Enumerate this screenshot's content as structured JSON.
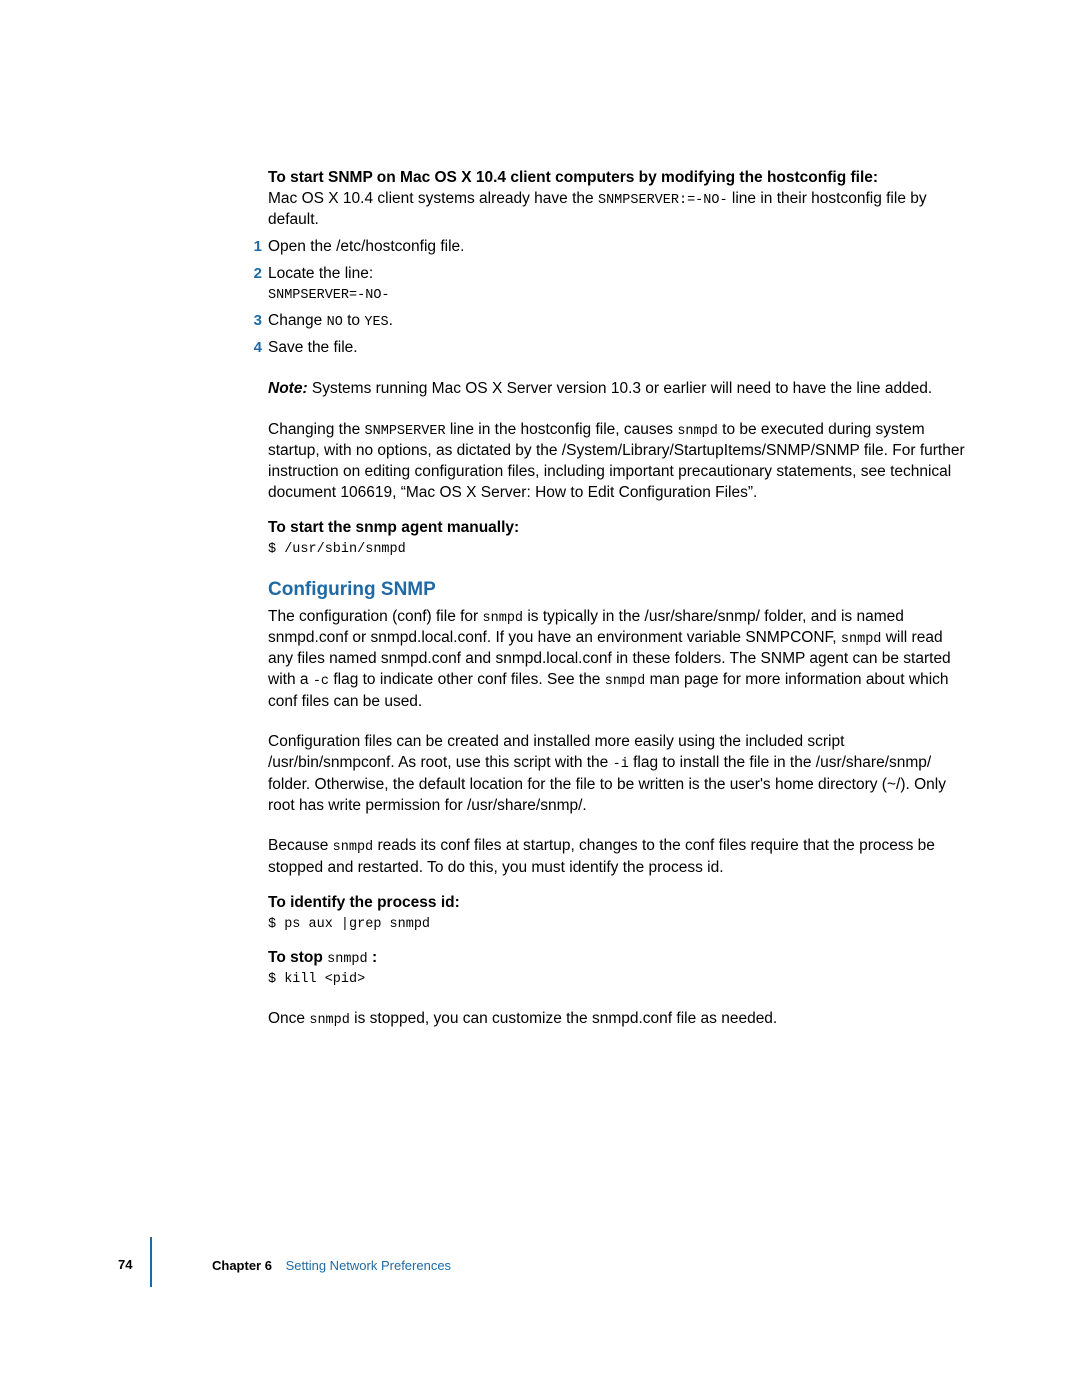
{
  "intro_heading": "To start SNMP on Mac OS X 10.4 client computers by modifying the hostconfig file:",
  "intro_text_1": "Mac OS X 10.4 client systems already have the ",
  "intro_code_1": "SNMPSERVER:=-NO-",
  "intro_text_2": " line in their hostconfig file by default.",
  "steps": [
    {
      "num": "1",
      "text": "Open the /etc/hostconfig file."
    },
    {
      "num": "2",
      "text": "Locate the line:",
      "code": "SNMPSERVER=-NO-"
    },
    {
      "num": "3",
      "parts": [
        {
          "t": "Change "
        },
        {
          "t": "NO",
          "code": true
        },
        {
          "t": " to "
        },
        {
          "t": "YES",
          "code": true
        },
        {
          "t": "."
        }
      ]
    },
    {
      "num": "4",
      "text": "Save the file."
    }
  ],
  "note_label": "Note:",
  "note_text": "  Systems running Mac OS X Server version 10.3 or earlier will need to have the line added.",
  "para_changing_parts": [
    {
      "t": "Changing the "
    },
    {
      "t": "SNMPSERVER",
      "code": true
    },
    {
      "t": " line in the hostconfig file, causes "
    },
    {
      "t": "snmpd",
      "code": true
    },
    {
      "t": " to be executed during system startup, with no options, as dictated by the /System/Library/StartupItems/SNMP/SNMP file. For further instruction on editing configuration files, including important precautionary statements, see technical document 106619, “Mac OS X Server: How to Edit Configuration Files”."
    }
  ],
  "manual_heading": "To start the snmp agent manually:",
  "manual_code": "$ /usr/sbin/snmpd",
  "config_heading": "Configuring SNMP",
  "config_p1_parts": [
    {
      "t": "The configuration (conf) file for "
    },
    {
      "t": "snmpd",
      "code": true
    },
    {
      "t": " is typically in the /usr/share/snmp/ folder, and is named snmpd.conf or snmpd.local.conf. If you have an environment variable SNMPCONF, "
    },
    {
      "t": "snmpd",
      "code": true
    },
    {
      "t": " will read any files named snmpd.conf and snmpd.local.conf in these folders. The SNMP agent can be started with a "
    },
    {
      "t": "-c",
      "code": true
    },
    {
      "t": " flag to indicate other conf files. See the "
    },
    {
      "t": "snmpd",
      "code": true
    },
    {
      "t": " man page for more information about which conf files can be used."
    }
  ],
  "config_p2_parts": [
    {
      "t": "Configuration files can be created and installed more easily using the included script /usr/bin/snmpconf. As root, use this script with the "
    },
    {
      "t": "-i",
      "code": true
    },
    {
      "t": " flag to install the file in the /usr/share/snmp/ folder. Otherwise, the default location for the file to be written is the user's home directory (~/). Only root has write permission for /usr/share/snmp/."
    }
  ],
  "config_p3_parts": [
    {
      "t": "Because "
    },
    {
      "t": "snmpd",
      "code": true
    },
    {
      "t": " reads its conf files at startup, changes to the conf files require that the process be stopped and restarted. To do this, you must identify the process id."
    }
  ],
  "identify_heading": "To identify the process id:",
  "identify_code": "$ ps aux |grep snmpd",
  "stop_heading_pre": "To stop ",
  "stop_heading_code": "snmpd",
  "stop_heading_post": " :",
  "stop_code": "$ kill <pid>",
  "final_parts": [
    {
      "t": "Once "
    },
    {
      "t": "snmpd",
      "code": true
    },
    {
      "t": " is stopped, you can customize the snmpd.conf file as needed."
    }
  ],
  "footer": {
    "page": "74",
    "chapter_label": "Chapter 6",
    "chapter_title": "Setting Network Preferences"
  }
}
